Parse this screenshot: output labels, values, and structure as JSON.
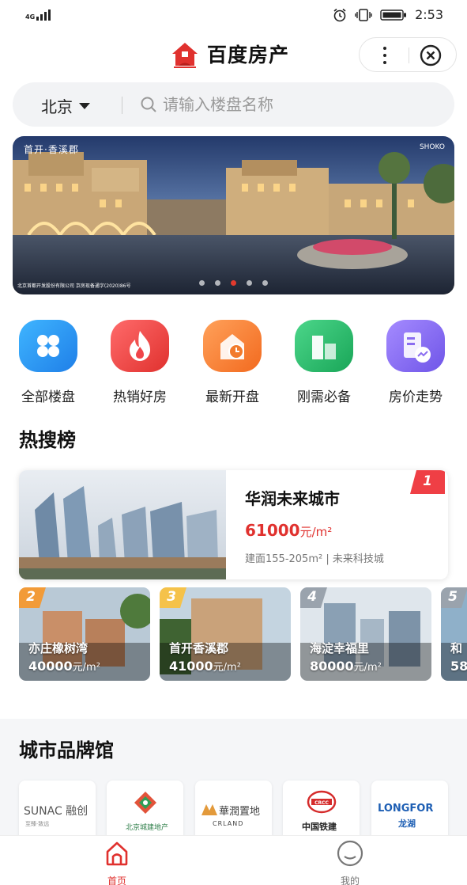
{
  "status_bar": {
    "network": "4G",
    "time": "2:53"
  },
  "header": {
    "title": "百度房产",
    "more_icon": "more-dots-icon",
    "close_icon": "close-circle-icon"
  },
  "search": {
    "city": "北京",
    "placeholder": "请输入楼盘名称"
  },
  "banner": {
    "brand": "首开·香溪郡",
    "brand_right": "SHOKO",
    "note": "北京首都开发股份有限公司  京房现备通字(2020)86号",
    "dots": 5,
    "active_dot": 2
  },
  "quick_entries": [
    {
      "label": "全部楼盘",
      "icon": "grid-icon",
      "color": "#2b9cf3"
    },
    {
      "label": "热销好房",
      "icon": "flame-icon",
      "color": "#f0454a"
    },
    {
      "label": "最新开盘",
      "icon": "clock-house-icon",
      "color": "#f27a2c"
    },
    {
      "label": "刚需必备",
      "icon": "buildings-icon",
      "color": "#2fbf6b"
    },
    {
      "label": "房价走势",
      "icon": "chart-doc-icon",
      "color": "#8a6cf0"
    }
  ],
  "hot_search": {
    "title": "热搜榜",
    "top": {
      "rank": "1",
      "name": "华润未来城市",
      "price": "61000",
      "unit": "元/m²",
      "desc": "建面155-205m² | 未来科技城"
    },
    "items": [
      {
        "rank": "2",
        "name": "亦庄橡树湾",
        "price": "40000",
        "unit": "元/m²"
      },
      {
        "rank": "3",
        "name": "首开香溪郡",
        "price": "41000",
        "unit": "元/m²"
      },
      {
        "rank": "4",
        "name": "海淀幸福里",
        "price": "80000",
        "unit": "元/m²"
      },
      {
        "rank": "5",
        "name": "和",
        "price": "58",
        "unit": ""
      }
    ]
  },
  "brand_hall": {
    "title": "城市品牌馆",
    "brands": [
      {
        "name": "SUNAC 融创",
        "sub": "至臻·致远"
      },
      {
        "name": "北京城建地产",
        "sub": ""
      },
      {
        "name": "華潤置地",
        "sub": "CRLAND"
      },
      {
        "name": "中国铁建",
        "sub": "CRCC"
      },
      {
        "name": "LONGFOR",
        "sub": "龙湖"
      }
    ]
  },
  "tabbar": {
    "tabs": [
      {
        "label": "首页",
        "icon": "home-icon",
        "active": true
      },
      {
        "label": "我的",
        "icon": "profile-icon",
        "active": false
      }
    ]
  },
  "colors": {
    "accent": "#e0312e",
    "text": "#222222",
    "muted": "#9a9a9a"
  }
}
